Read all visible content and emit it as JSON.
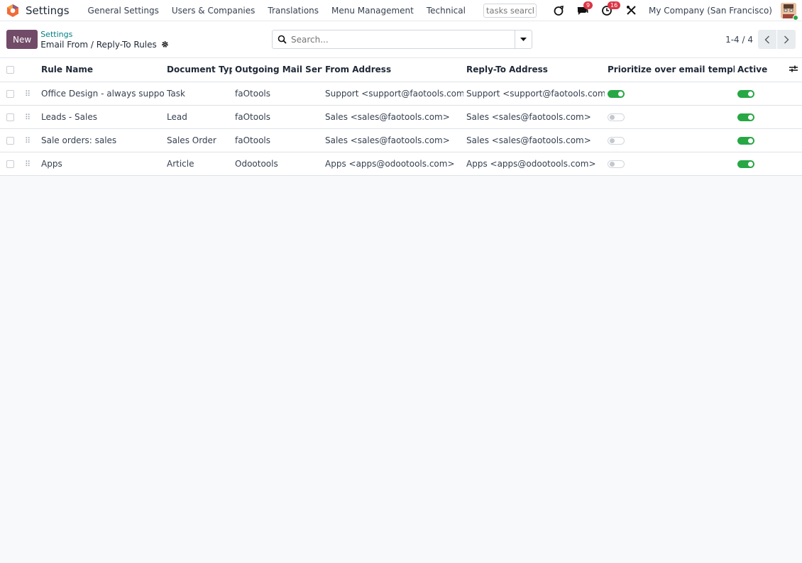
{
  "navbar": {
    "app_name": "Settings",
    "menu": [
      "General Settings",
      "Users & Companies",
      "Translations",
      "Menu Management",
      "Technical"
    ],
    "tasks_search_placeholder": "tasks search",
    "messages_count": "9",
    "activities_count": "16",
    "company": "My Company (San Francisco)"
  },
  "control": {
    "new_label": "New",
    "breadcrumb_parent": "Settings",
    "breadcrumb_current": "Email From / Reply-To Rules",
    "search_placeholder": "Search...",
    "pager": "1-4 / 4"
  },
  "table": {
    "columns": [
      "Rule Name",
      "Document Type",
      "Outgoing Mail Server",
      "From Address",
      "Reply-To Address",
      "Prioritize over email templates",
      "Active"
    ],
    "rows": [
      {
        "rule_name": "Office Design - always support",
        "document_type": "Task",
        "mail_server": "faOtools",
        "from": "Support <support@faotools.com>",
        "reply_to": "Support <support@faotools.com>",
        "prioritize": true,
        "active": true
      },
      {
        "rule_name": "Leads - Sales",
        "document_type": "Lead",
        "mail_server": "faOtools",
        "from": "Sales <sales@faotools.com>",
        "reply_to": "Sales <sales@faotools.com>",
        "prioritize": false,
        "active": true
      },
      {
        "rule_name": "Sale orders: sales",
        "document_type": "Sales Order",
        "mail_server": "faOtools",
        "from": "Sales <sales@faotools.com>",
        "reply_to": "Sales <sales@faotools.com>",
        "prioritize": false,
        "active": true
      },
      {
        "rule_name": "Apps",
        "document_type": "Article",
        "mail_server": "Odootools",
        "from": "Apps <apps@odootools.com>",
        "reply_to": "Apps <apps@odootools.com>",
        "prioritize": false,
        "active": true
      }
    ]
  },
  "colors": {
    "brand": "#714b67",
    "link": "#017e84",
    "toggle_on": "#28a745",
    "badge": "#dc3545"
  }
}
